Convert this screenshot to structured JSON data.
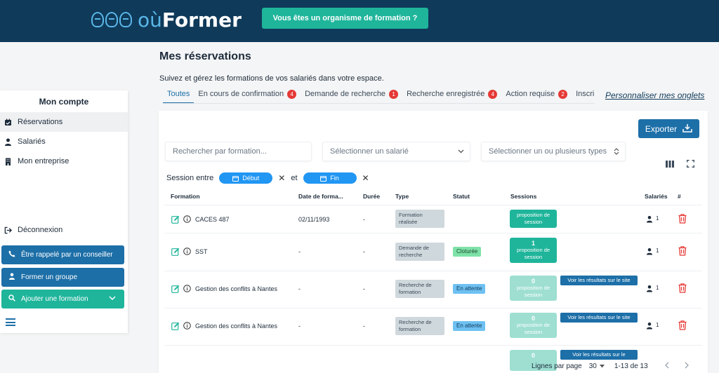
{
  "header": {
    "logo_prefix": "où",
    "logo_name": "Former",
    "cta_label": "Vous êtes un organisme de formation ?"
  },
  "page": {
    "title": "Mes réservations",
    "subtitle": "Suivez et gérez les formations de vos salariés dans votre espace."
  },
  "tabs": [
    {
      "label": "Toutes",
      "badge": ""
    },
    {
      "label": "En cours de confirmation",
      "badge": "4"
    },
    {
      "label": "Demande de recherche",
      "badge": "1"
    },
    {
      "label": "Recherche enregistrée",
      "badge": "4"
    },
    {
      "label": "Action requise",
      "badge": "2"
    },
    {
      "label": "Inscri",
      "badge": ""
    }
  ],
  "custom_tabs_label": "Personnaliser mes onglets",
  "sidebar": {
    "title": "Mon compte",
    "items": [
      {
        "label": "Réservations",
        "icon": "calendar-check-icon"
      },
      {
        "label": "Salariés",
        "icon": "user-icon"
      },
      {
        "label": "Mon entreprise",
        "icon": "building-icon"
      }
    ],
    "logout_label": "Déconnexion",
    "buttons": {
      "callback": "Être rappelé par un conseiller",
      "group": "Former un groupe",
      "add_training": "Ajouter une formation"
    }
  },
  "toolbar": {
    "export_label": "Exporter",
    "search_placeholder": "Rechercher par formation...",
    "employee_select": "Sélectionner un salarié",
    "types_select": "Sélectionner un ou plusieurs types"
  },
  "session_filter": {
    "label": "Session entre",
    "start": "Début",
    "and": "et",
    "end": "Fin"
  },
  "table": {
    "headers": {
      "formation": "Formation",
      "date": "Date de forma...",
      "duration": "Durée",
      "type": "Type",
      "status": "Statut",
      "sessions": "Sessions",
      "employees": "Salariés",
      "hash": "#"
    },
    "rows": [
      {
        "name": "CACES 487",
        "date": "02/11/1993",
        "duration": "-",
        "type": "Formation réalisée",
        "status": "",
        "session_count": "",
        "session_label": "proposition de session",
        "result": "",
        "employees": "1"
      },
      {
        "name": "SST",
        "date": "-",
        "duration": "-",
        "type": "Demande de recherche",
        "status": "Cloturée",
        "session_count": "1",
        "session_label": "proposition de session",
        "result": "",
        "employees": "1"
      },
      {
        "name": "Gestion des conflits à Nantes",
        "date": "-",
        "duration": "-",
        "type": "Recherche de formation",
        "status": "En attente",
        "session_count": "0",
        "session_label": "proposition de session",
        "result": "Voir les résultats sur le site",
        "employees": "1"
      },
      {
        "name": "Gestion des conflits à Nantes",
        "date": "-",
        "duration": "-",
        "type": "Recherche de formation",
        "status": "En attente",
        "session_count": "0",
        "session_label": "proposition de session",
        "result": "Voir les résultats sur le site",
        "employees": "1"
      },
      {
        "name": "",
        "date": "",
        "duration": "",
        "type": "",
        "status": "",
        "session_count": "0",
        "session_label": "",
        "result": "Voir les résultats sur le",
        "employees": ""
      }
    ]
  },
  "pagination": {
    "rows_label": "Lignes par page",
    "rows_value": "30",
    "range": "1-13 de 13"
  },
  "colors": {
    "header_bg": "#0f3a5a",
    "accent_green": "#1fb59b",
    "accent_blue": "#1d6fa8",
    "badge_red": "#e53935",
    "status_closed": "#7ee2a8",
    "status_waiting": "#6ec1f2"
  }
}
